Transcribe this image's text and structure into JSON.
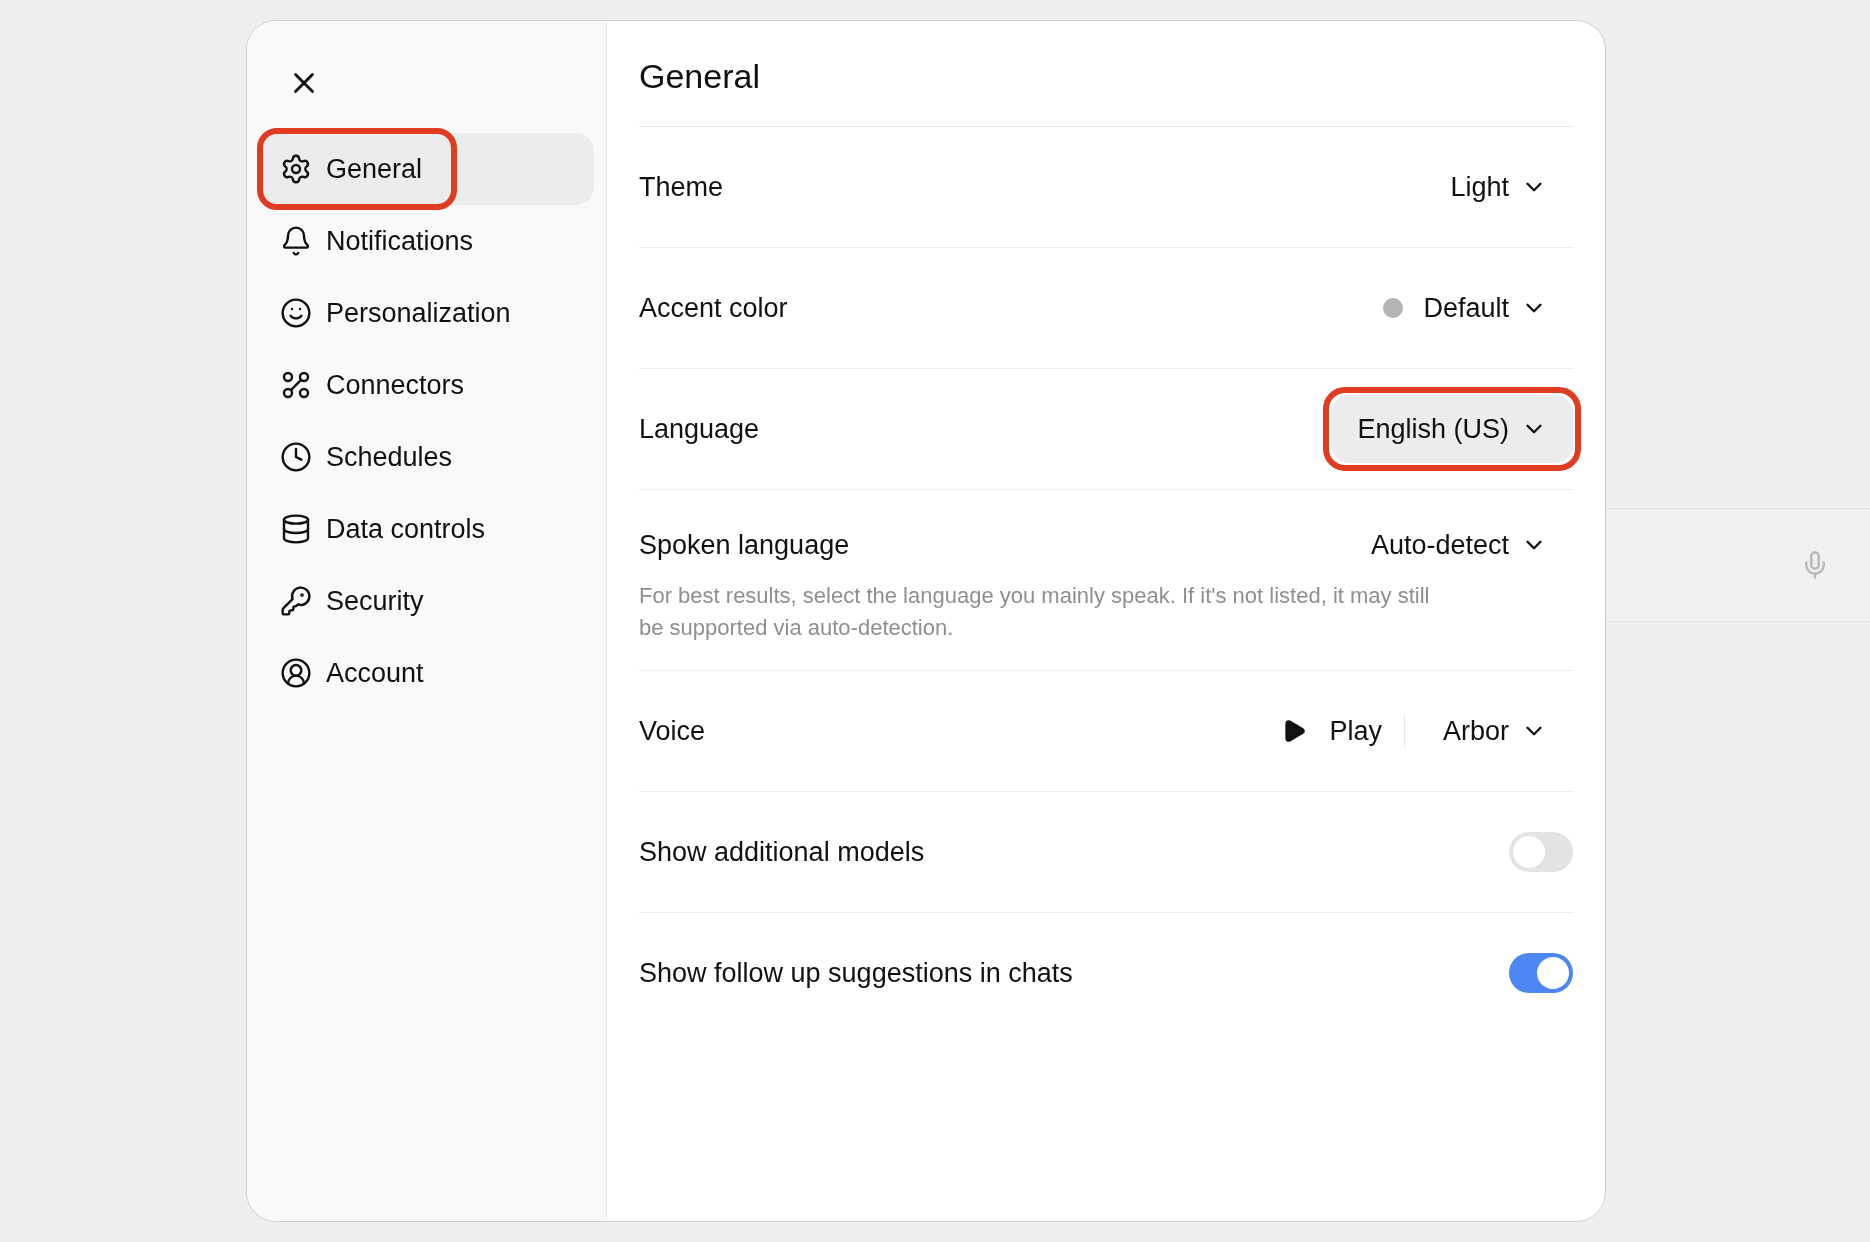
{
  "sidebar": {
    "items": [
      {
        "label": "General",
        "selected": true,
        "annotated": true
      },
      {
        "label": "Notifications",
        "selected": false,
        "annotated": false
      },
      {
        "label": "Personalization",
        "selected": false,
        "annotated": false
      },
      {
        "label": "Connectors",
        "selected": false,
        "annotated": false
      },
      {
        "label": "Schedules",
        "selected": false,
        "annotated": false
      },
      {
        "label": "Data controls",
        "selected": false,
        "annotated": false
      },
      {
        "label": "Security",
        "selected": false,
        "annotated": false
      },
      {
        "label": "Account",
        "selected": false,
        "annotated": false
      }
    ]
  },
  "panel": {
    "title": "General",
    "settings": [
      {
        "kind": "select",
        "label": "Theme",
        "value": "Light",
        "highlighted": false,
        "annotated": false
      },
      {
        "kind": "select",
        "label": "Accent color",
        "value": "Default",
        "color": "#b3b3b3",
        "highlighted": false,
        "annotated": false
      },
      {
        "kind": "select",
        "label": "Language",
        "value": "English (US)",
        "highlighted": true,
        "annotated": true
      },
      {
        "kind": "select",
        "label": "Spoken language",
        "value": "Auto-detect",
        "highlighted": false,
        "annotated": false,
        "description": "For best results, select the language you mainly speak. If it's not listed, it may still be supported via auto-detection."
      },
      {
        "kind": "voice",
        "label": "Voice",
        "play_label": "Play",
        "value": "Arbor"
      },
      {
        "kind": "toggle",
        "label": "Show additional models",
        "on": false
      },
      {
        "kind": "toggle",
        "label": "Show follow up suggestions in chats",
        "on": true
      }
    ]
  }
}
